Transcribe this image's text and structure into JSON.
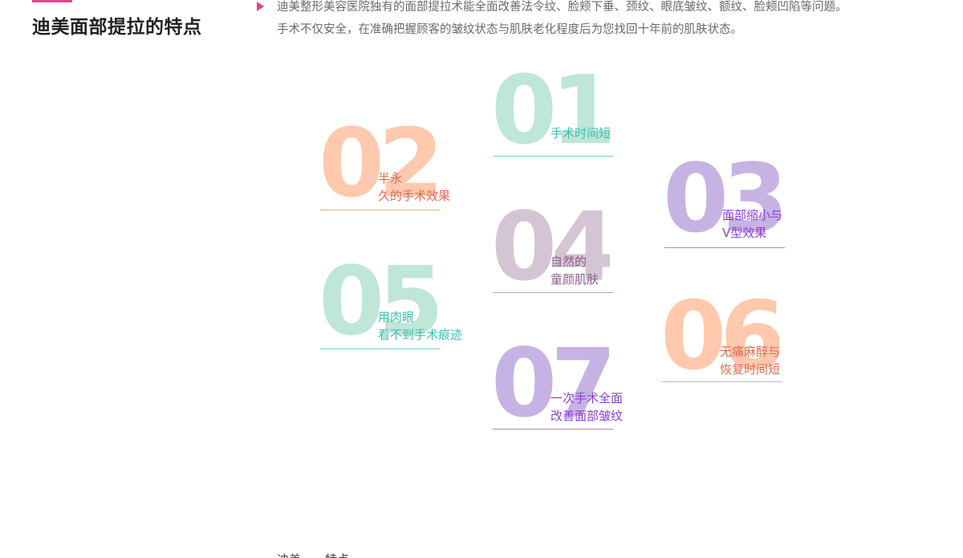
{
  "section": {
    "title": "迪美面部提拉的特点"
  },
  "intro": {
    "line1": "迪美整形美容医院独有的面部提拉术能全面改善法令纹、脸颊下垂、颈纹、眼底皱纹、额纹、脸颊凹陷等问题。",
    "line2": "手术不仅安全，在准确把握顾客的皱纹状态与肌肤老化程度后为您找回十年前的肌肤状态。"
  },
  "features": [
    {
      "num": "01",
      "line1": "手术时间短",
      "line2": "",
      "color": "#bfe6d6",
      "text_color": "#3cbfae",
      "line_color": "#7fcfc2"
    },
    {
      "num": "02",
      "line1": "半永",
      "line2": "久的手术效果",
      "color": "#ffc9ad",
      "text_color": "#e06a52",
      "line_color": "#f0a98e"
    },
    {
      "num": "03",
      "line1": "面部缩小与",
      "line2": "V型效果",
      "color": "#c6b3e3",
      "text_color": "#8a3fd6",
      "line_color": "#a78acb"
    },
    {
      "num": "04",
      "line1": "自然的",
      "line2": "童颜肌肤",
      "color": "#d4c5d4",
      "text_color": "#8e5a8e",
      "line_color": "#b8a6b8"
    },
    {
      "num": "05",
      "line1": "用肉眼",
      "line2": "看不到手术痕迹",
      "color": "#bfe6d6",
      "text_color": "#3cbfae",
      "line_color": "#7fcfc2"
    },
    {
      "num": "06",
      "line1": "无痛麻醉与",
      "line2": "恢复时间短",
      "color": "#ffc9ad",
      "text_color": "#e06a52",
      "line_color": "#f0a98e"
    },
    {
      "num": "07",
      "line1": "一次手术全面",
      "line2": "改善面部皱纹",
      "color": "#c6b3e3",
      "text_color": "#8a3fd6",
      "line_color": "#a78acb"
    }
  ],
  "footer": {
    "partial_text": "迪美……特点"
  }
}
